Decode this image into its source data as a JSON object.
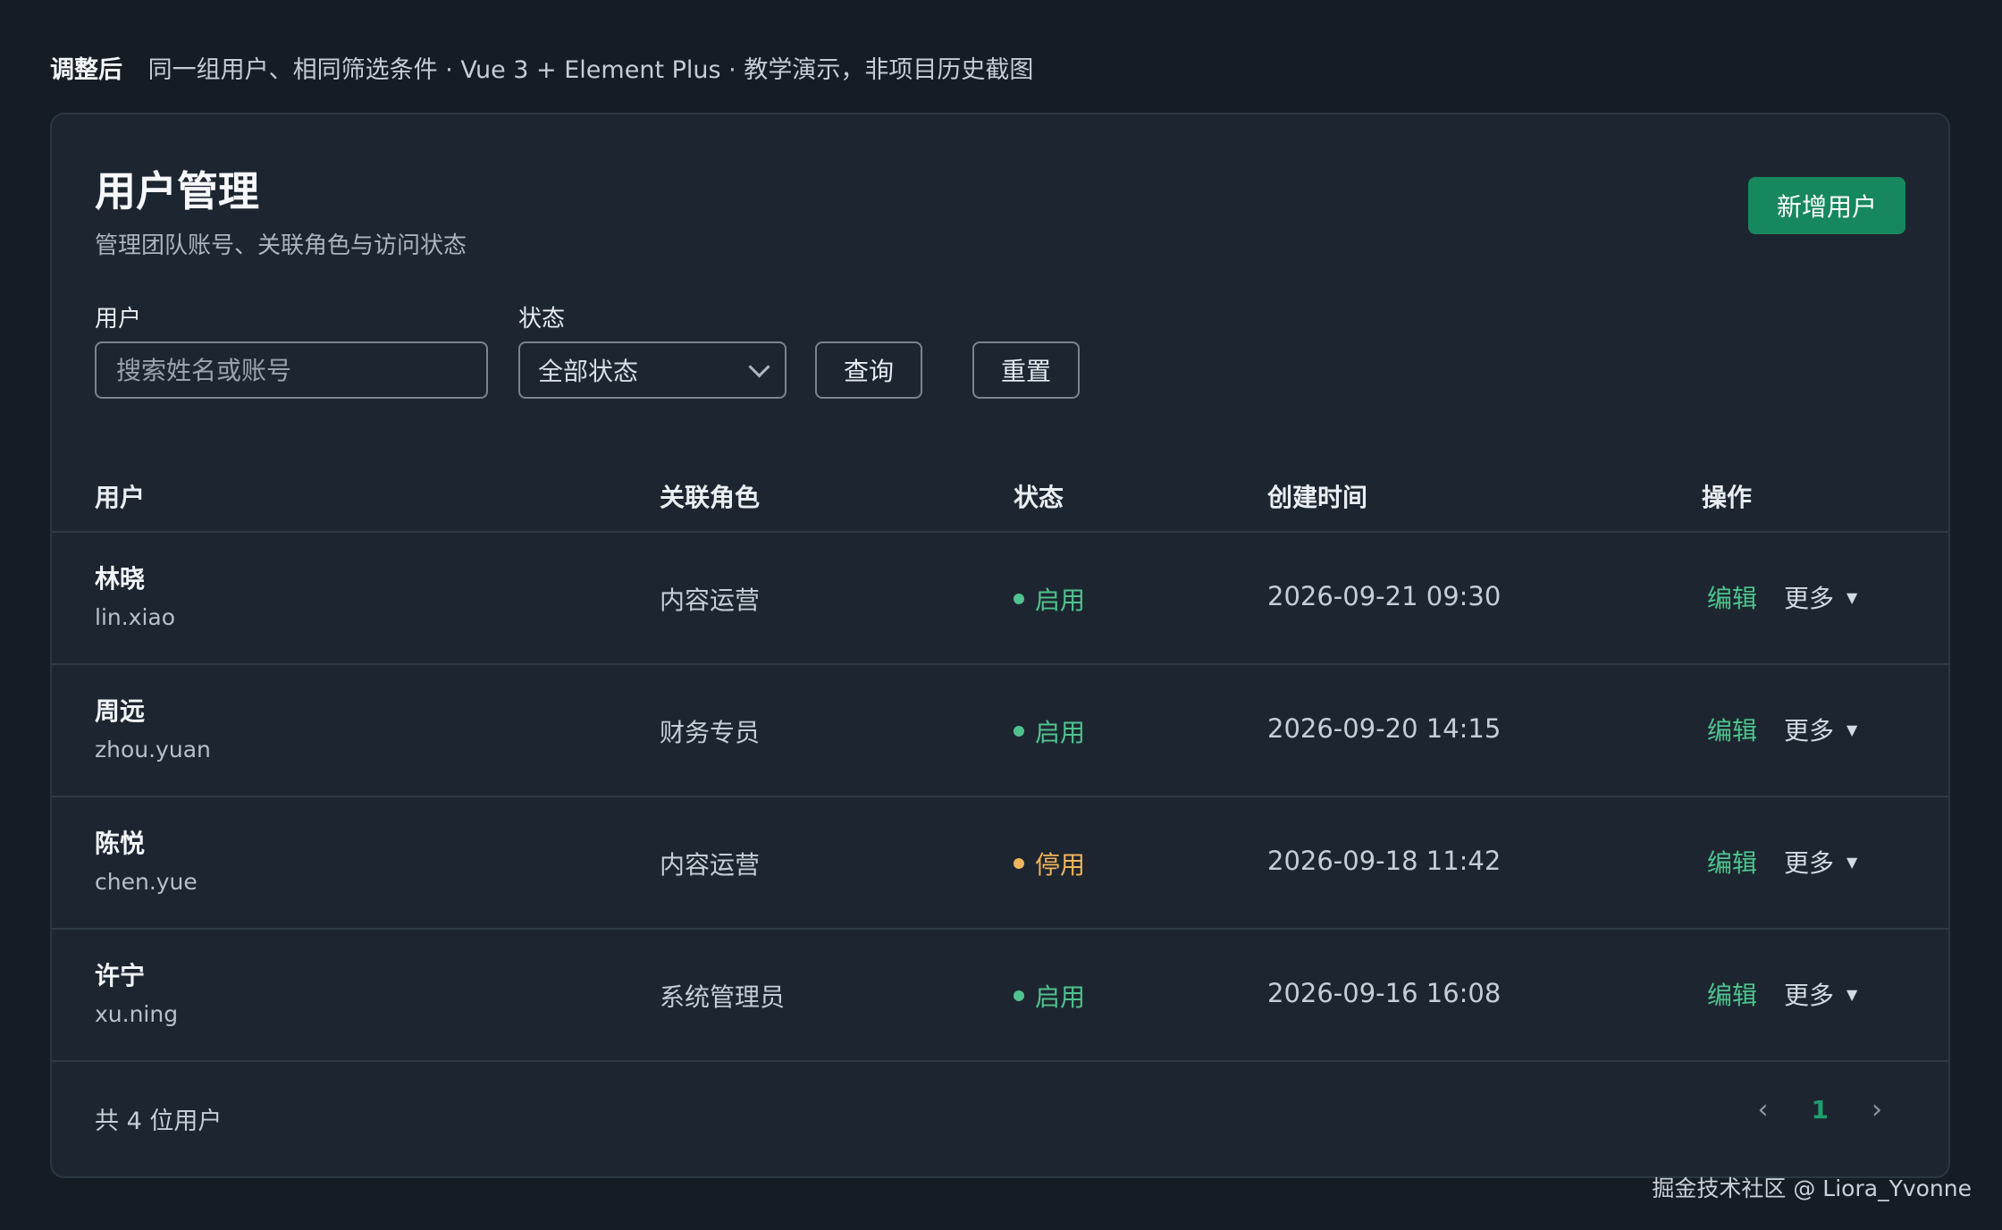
{
  "top_note": {
    "label": "调整后",
    "text": "同一组用户、相同筛选条件 · Vue 3 + Element Plus · 教学演示，非项目历史截图"
  },
  "page": {
    "title": "用户管理",
    "subtitle": "管理团队账号、关联角色与访问状态",
    "add_button": "新增用户"
  },
  "filters": {
    "user_label": "用户",
    "user_placeholder": "搜索姓名或账号",
    "status_label": "状态",
    "status_value": "全部状态",
    "query_button": "查询",
    "reset_button": "重置"
  },
  "table": {
    "headers": [
      "用户",
      "关联角色",
      "状态",
      "创建时间",
      "操作"
    ],
    "rows": [
      {
        "name": "林晓",
        "account": "lin.xiao",
        "role": "内容运营",
        "status": "启用",
        "status_type": "active",
        "created": "2026-09-21 09:30",
        "edit": "编辑",
        "more": "更多"
      },
      {
        "name": "周远",
        "account": "zhou.yuan",
        "role": "财务专员",
        "status": "启用",
        "status_type": "active",
        "created": "2026-09-20 14:15",
        "edit": "编辑",
        "more": "更多"
      },
      {
        "name": "陈悦",
        "account": "chen.yue",
        "role": "内容运营",
        "status": "停用",
        "status_type": "disabled",
        "created": "2026-09-18 11:42",
        "edit": "编辑",
        "more": "更多"
      },
      {
        "name": "许宁",
        "account": "xu.ning",
        "role": "系统管理员",
        "status": "启用",
        "status_type": "active",
        "created": "2026-09-16 16:08",
        "edit": "编辑",
        "more": "更多"
      }
    ]
  },
  "footer": {
    "total": "共 4 位用户",
    "current_page": "1"
  },
  "colors": {
    "active": "#4fc38f",
    "disabled": "#f0b45a",
    "brand": "#17875e"
  },
  "icons": {
    "select": "chevron-down-icon",
    "more": "caret-down-icon",
    "prev": "chevron-left-icon",
    "next": "chevron-right-icon"
  },
  "watermark": "掘金技术社区 @ Liora_Yvonne"
}
